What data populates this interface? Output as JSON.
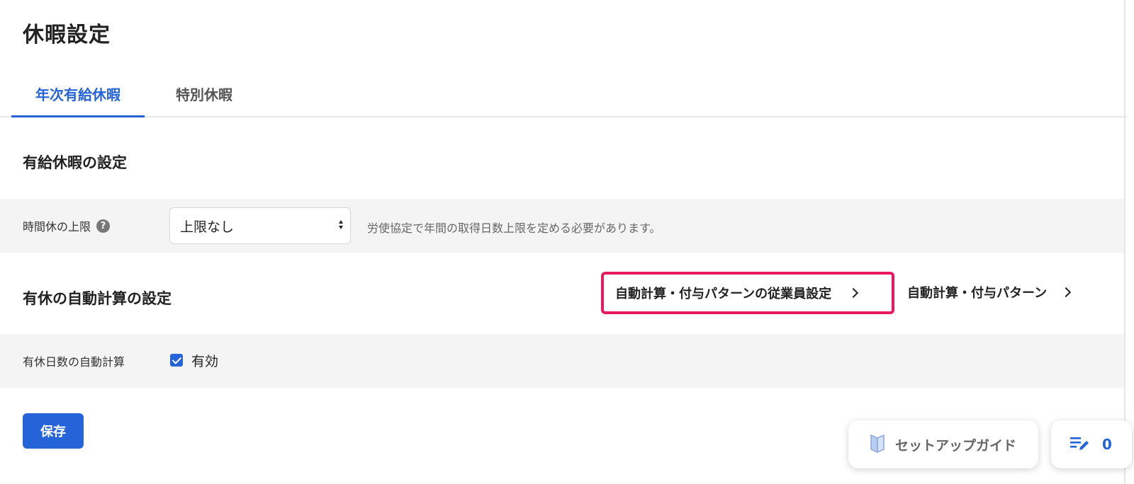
{
  "page": {
    "title": "休暇設定"
  },
  "tabs": [
    {
      "label": "年次有給休暇",
      "active": true
    },
    {
      "label": "特別休暇",
      "active": false
    }
  ],
  "paid_leave_section": {
    "heading": "有給休暇の設定",
    "hourly_limit": {
      "label": "時間休の上限",
      "help_icon": "question-circle-icon",
      "selected_value": "上限なし",
      "hint": "労使協定で年間の取得日数上限を定める必要があります。"
    }
  },
  "auto_calc_section": {
    "heading": "有休の自動計算の設定",
    "employee_settings_link": "自動計算・付与パターンの従業員設定",
    "pattern_link": "自動計算・付与パターン",
    "auto_calc_row": {
      "label": "有休日数の自動計算",
      "checkbox_label": "有効",
      "checked": true
    }
  },
  "actions": {
    "save_label": "保存"
  },
  "floating": {
    "setup_guide_label": "セットアップガイド",
    "memo_count": "0"
  },
  "colors": {
    "accent": "#2563d8",
    "highlight_border": "#e8195c",
    "row_background": "#f5f4f4"
  }
}
